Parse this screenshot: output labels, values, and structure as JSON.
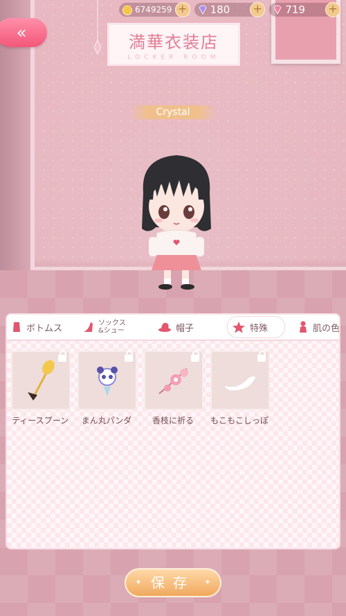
{
  "currency": {
    "coins": "6749259",
    "gems": "180",
    "diamonds": "719",
    "plus": "+"
  },
  "shop": {
    "title": "満華衣装店",
    "subtitle": "LOCKER ROOM"
  },
  "character": {
    "name": "Crystal"
  },
  "tabs": [
    {
      "label": "ボトムス",
      "icon": "skirt-icon"
    },
    {
      "label1": "ソックス",
      "label2": "&シュー",
      "icon": "high-heel-icon"
    },
    {
      "label": "帽子",
      "icon": "hat-icon"
    },
    {
      "label": "特殊",
      "icon": "star-icon",
      "active": true
    },
    {
      "label": "肌の色",
      "icon": "person-icon"
    }
  ],
  "items": [
    {
      "label": "ティースプーン",
      "icon": "teaspoon-icon"
    },
    {
      "label": "まん丸パンダ",
      "icon": "panda-icon"
    },
    {
      "label": "香枝に祈る",
      "icon": "pink-flower-branch-icon"
    },
    {
      "label": "もこもこしっぽ",
      "icon": "fluffy-tail-icon"
    }
  ],
  "save": {
    "label": "保存"
  },
  "back": {
    "label": "«"
  },
  "colors": {
    "accent_pink": "#f3577a",
    "save_orange": "#f0a95d",
    "panel_bg": "#fff6f8"
  }
}
